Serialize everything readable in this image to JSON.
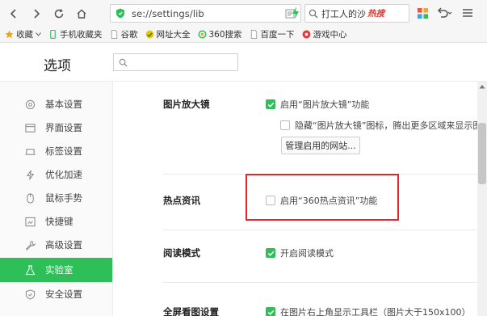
{
  "toolbar": {
    "address": "se://settings/lib",
    "search_text": "打工人的沙",
    "search_badge": "热搜"
  },
  "bookmarks": [
    {
      "label": "收藏",
      "icon": "star-icon"
    },
    {
      "label": "手机收藏夹",
      "icon": "phone-icon"
    },
    {
      "label": "谷歌",
      "icon": "page-icon"
    },
    {
      "label": "网址大全",
      "icon": "globe-icon"
    },
    {
      "label": "360搜索",
      "icon": "search-360-icon"
    },
    {
      "label": "百度一下",
      "icon": "page-icon"
    },
    {
      "label": "游戏中心",
      "icon": "game-icon"
    }
  ],
  "settings": {
    "title": "选项"
  },
  "sidebar": {
    "items": [
      {
        "label": "基本设置",
        "icon": "settings-icon"
      },
      {
        "label": "界面设置",
        "icon": "window-icon"
      },
      {
        "label": "标签设置",
        "icon": "tab-icon"
      },
      {
        "label": "优化加速",
        "icon": "lightning-icon"
      },
      {
        "label": "鼠标手势",
        "icon": "mouse-icon"
      },
      {
        "label": "快捷键",
        "icon": "keyboard-icon"
      },
      {
        "label": "高级设置",
        "icon": "wrench-icon"
      },
      {
        "label": "实验室",
        "icon": "lab-icon"
      },
      {
        "label": "安全设置",
        "icon": "shield-icon"
      }
    ],
    "active_index": 7
  },
  "main": {
    "magnifier": {
      "title": "图片放大镜",
      "enable_label": "启用“图片放大镜”功能",
      "enable_checked": true,
      "hide_label": "隐藏“图片放大镜”图标，腾出更多区域来显示图片",
      "hide_checked": false,
      "manage_button": "管理启用的网站..."
    },
    "hotnews": {
      "title": "热点资讯",
      "enable_label": "启用“360热点资讯”功能",
      "enable_checked": false
    },
    "reading": {
      "title": "阅读模式",
      "enable_label": "开启阅读模式",
      "enable_checked": true
    },
    "fullscreen": {
      "title": "全屏看图设置",
      "enable_label": "在图片右上角显示工具栏（图片大于150x100）",
      "enable_checked": true
    }
  },
  "colors": {
    "accent": "#2fbf59",
    "highlight": "#e0262a",
    "hot": "#e53935"
  }
}
